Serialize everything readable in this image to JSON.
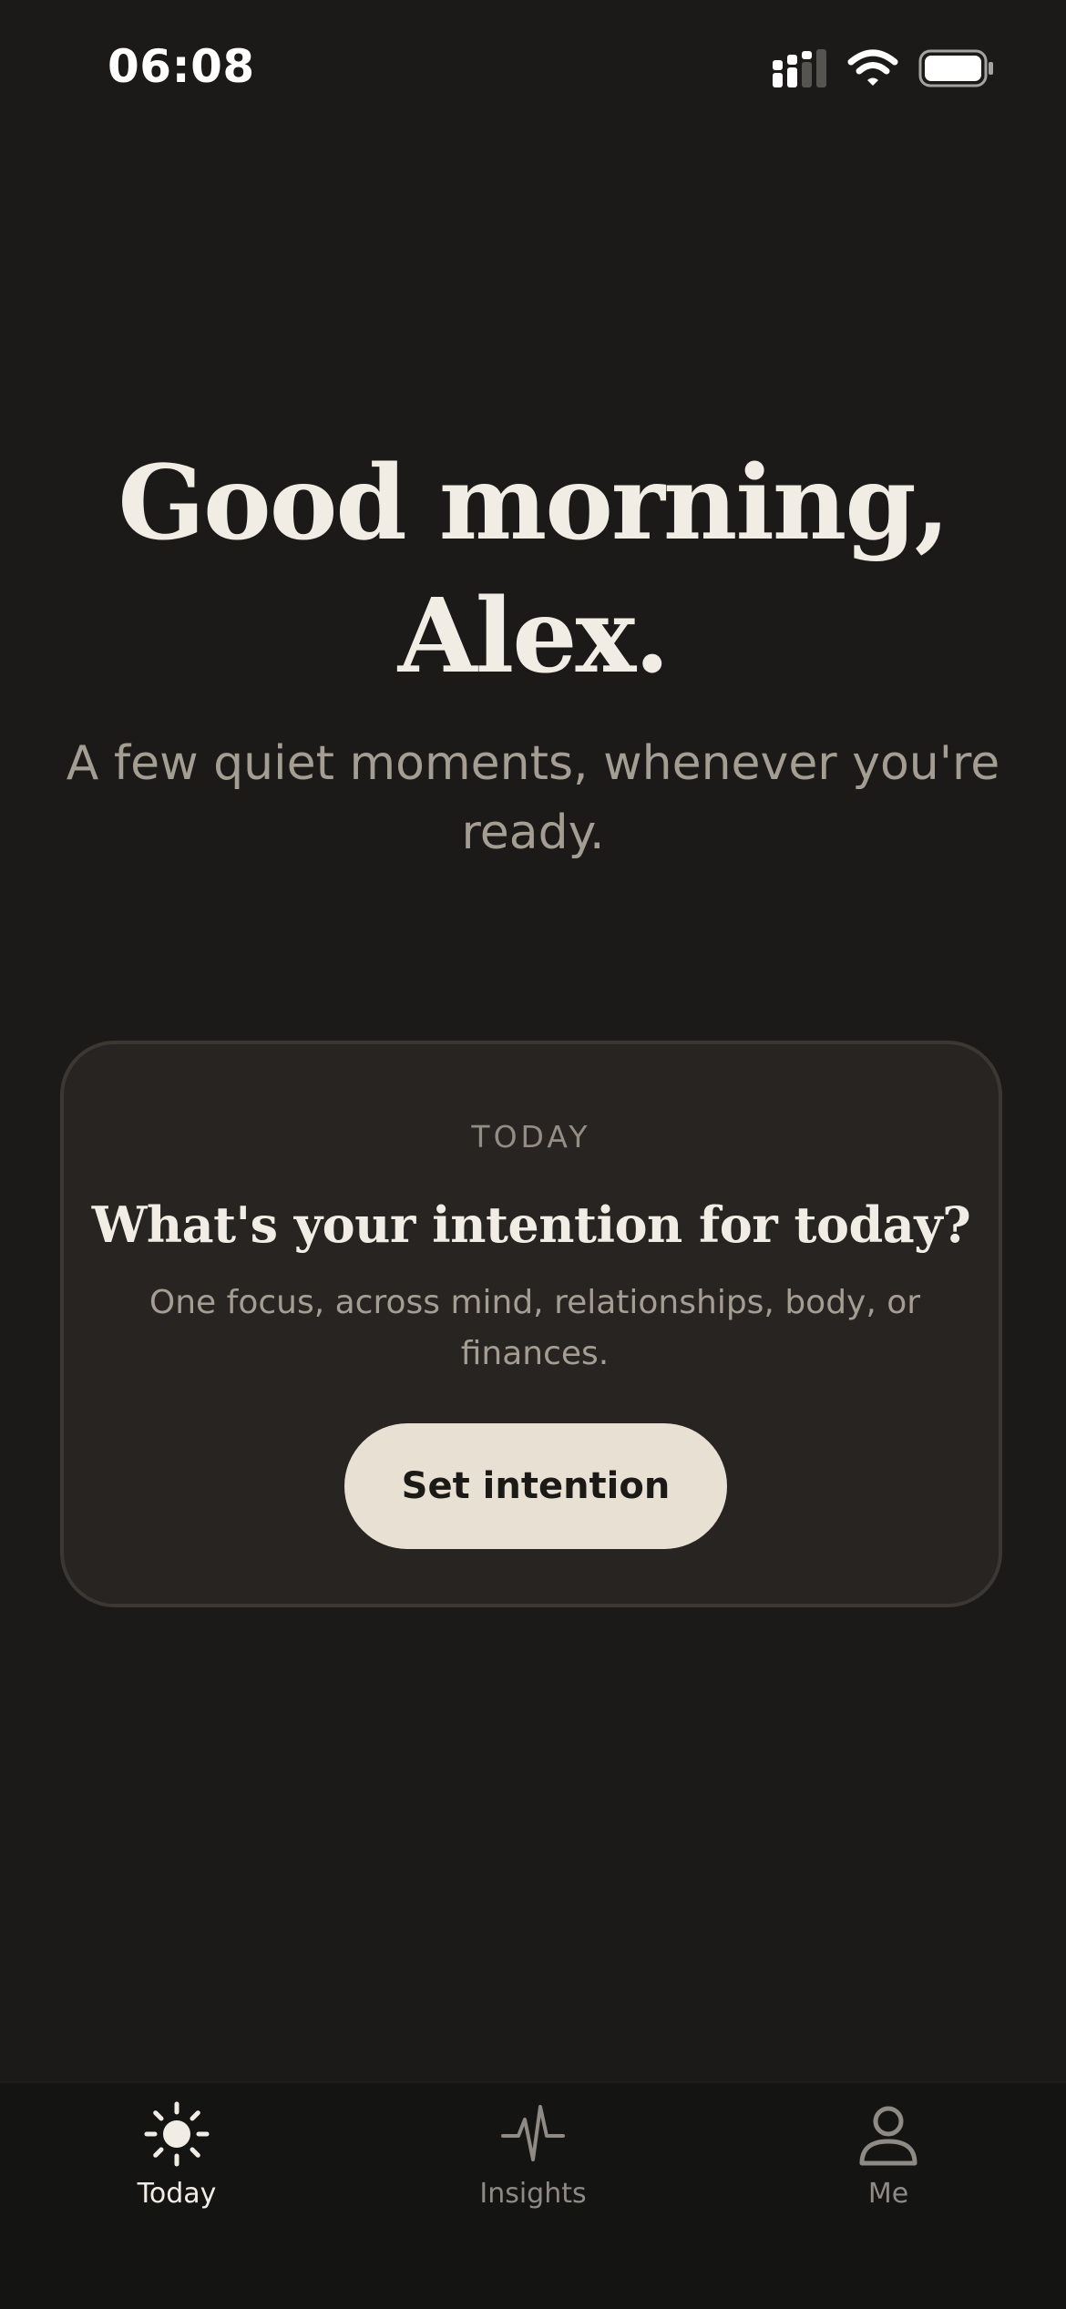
{
  "status_bar": {
    "time": "06:08",
    "icons": [
      "cellular-signal-icon",
      "wifi-icon",
      "battery-icon"
    ]
  },
  "greeting": {
    "line1": "Good morning,",
    "line2": "Alex."
  },
  "subtitle": "A few quiet moments, whenever you're ready.",
  "card": {
    "label": "TODAY",
    "title": "What's your intention for today?",
    "description": "One focus, across mind, relationships, body, or finances.",
    "button_label": "Set intention"
  },
  "tab_bar": {
    "tabs": [
      {
        "label": "Today",
        "icon": "sun-icon",
        "active": true
      },
      {
        "label": "Insights",
        "icon": "pulse-icon",
        "active": false
      },
      {
        "label": "Me",
        "icon": "person-icon",
        "active": false
      }
    ]
  },
  "colors": {
    "background": "#1b1a18",
    "card_background": "#272421",
    "card_border": "#3b3834",
    "primary_text": "#f2ede4",
    "secondary_text": "#a49d91",
    "button_background": "#e8e1d3",
    "tab_bar_background": "#141412"
  }
}
